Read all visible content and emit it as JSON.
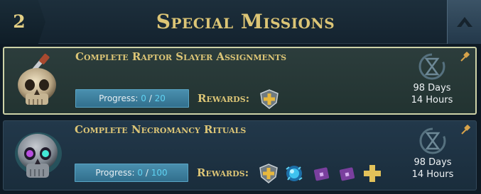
{
  "header": {
    "count": "2",
    "title": "Special Missions"
  },
  "missions": [
    {
      "title": "Complete Raptor Slayer Assignments",
      "progress_label": "Progress:",
      "progress_current": "0",
      "progress_sep": "/",
      "progress_total": "20",
      "progress_fraction": 0,
      "rewards_label": "Rewards:",
      "rewards": [
        "gold-shield-plus-icon"
      ],
      "time_days": "98 Days",
      "time_hours": "14 Hours",
      "icon": "skull-with-sword-icon",
      "selected": true
    },
    {
      "title": "Complete Necromancy Rituals",
      "progress_label": "Progress:",
      "progress_current": "0",
      "progress_sep": "/",
      "progress_total": "100",
      "progress_fraction": 0,
      "rewards_label": "Rewards:",
      "rewards": [
        "gold-shield-plus-icon",
        "blue-orb-icon",
        "purple-lock-card-icon",
        "purple-lock-card-icon",
        "gold-plus-icon"
      ],
      "time_days": "98 Days",
      "time_hours": "14 Hours",
      "icon": "glowing-skull-icon",
      "selected": false
    }
  ],
  "colors": {
    "gold_text": "#dcc576",
    "progress_fill": "#3f86a6",
    "progress_number": "#5fd3f3",
    "selected_border": "#cdd2a7",
    "background": "#0e1a24"
  }
}
